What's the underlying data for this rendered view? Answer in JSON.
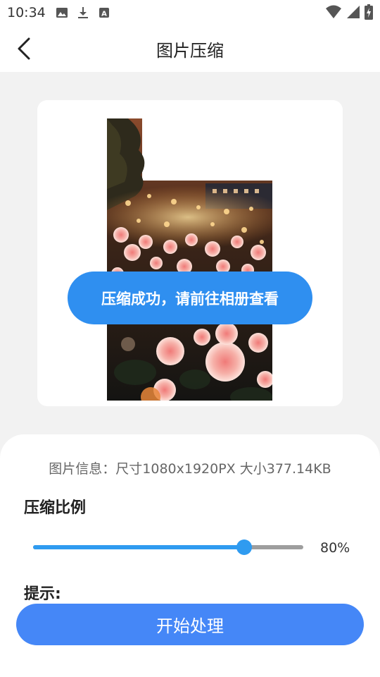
{
  "status_bar": {
    "time": "10:34",
    "icons_left": [
      "image-icon",
      "download-icon",
      "font-icon"
    ],
    "icons_right": [
      "wifi-icon",
      "signal-icon",
      "battery-charging-icon"
    ]
  },
  "header": {
    "title": "图片压缩",
    "back_icon": "chevron-left-icon"
  },
  "preview": {
    "description_icon": "photo-roses"
  },
  "toast": {
    "message": "压缩成功，请前往相册查看"
  },
  "panel": {
    "image_info": "图片信息：尺寸1080x1920PX 大小377.14KB",
    "ratio_title": "压缩比例",
    "ratio_value_text": "80%",
    "ratio_value": 0.78,
    "tip_title": "提示:",
    "start_button": "开始处理"
  },
  "colors": {
    "accent": "#2f9bf0",
    "toast_bg": "#2f8ff0",
    "button_bg": "#4587f7",
    "page_bg": "#f2f2f2"
  }
}
